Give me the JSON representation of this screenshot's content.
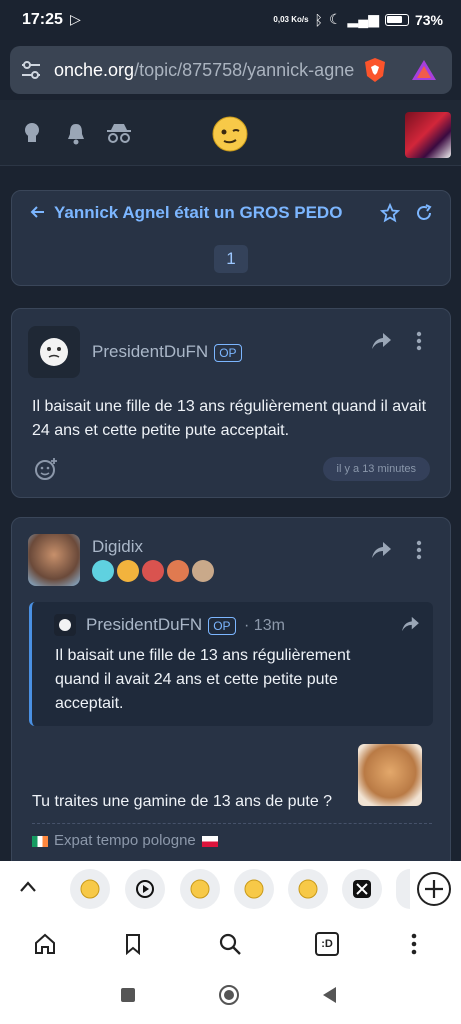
{
  "status": {
    "time": "17:25",
    "net_speed": "0,03 Ko/s",
    "battery": "73%"
  },
  "browser": {
    "url_host": "onche.org",
    "url_path": "/topic/875758/yannick-agne"
  },
  "topic": {
    "title": "Yannick Agnel était un GROS PEDO",
    "page": "1"
  },
  "post1": {
    "author": "PresidentDuFN",
    "op_label": "OP",
    "text": "Il baisait une fille de 13 ans régulièrement quand il avait 24 ans et cette petite pute acceptait.",
    "time": "il y a 13 minutes"
  },
  "post2": {
    "author": "Digidix",
    "quote": {
      "author": "PresidentDuFN",
      "op_label": "OP",
      "time": "· 13m",
      "text": "Il baisait une fille de 13 ans régulièrement quand il avait 24 ans et cette petite pute acceptait."
    },
    "text": "Tu traites une gamine de 13 ans de pute ?",
    "signature": "Expat tempo pologne"
  },
  "colors": {
    "accent": "#7cb6ff",
    "background": "#1b2330",
    "card": "#283345"
  }
}
